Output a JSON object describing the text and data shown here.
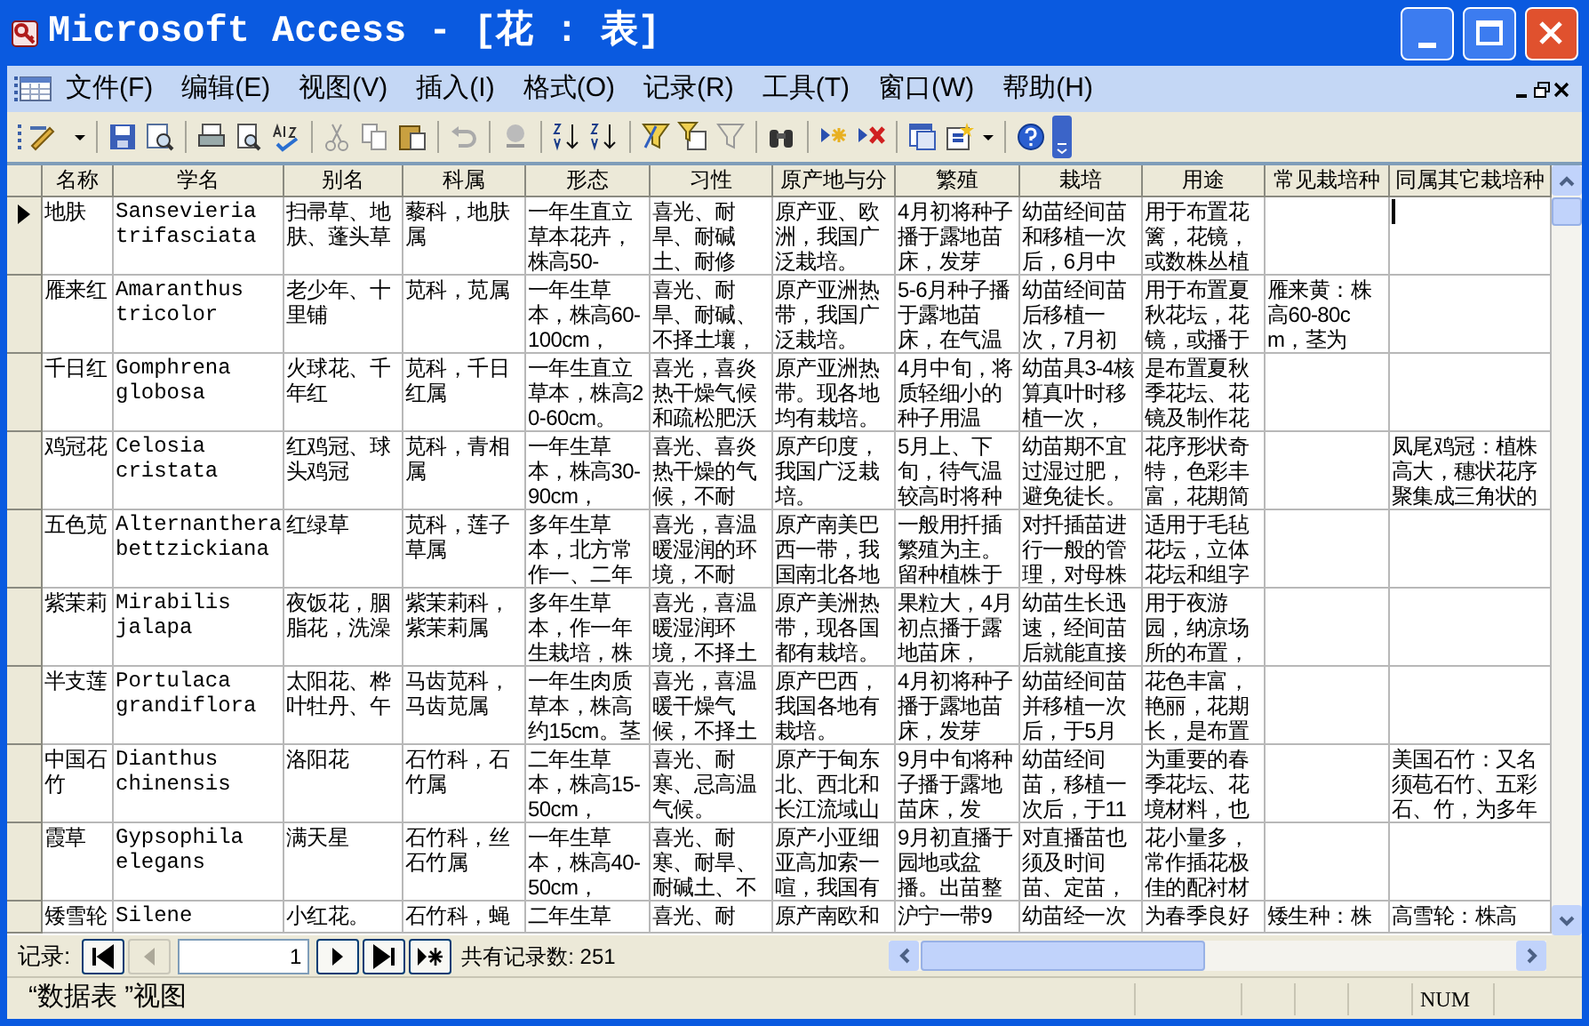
{
  "window": {
    "title": "Microsoft Access - [花 : 表]"
  },
  "menu": [
    "文件(F)",
    "编辑(E)",
    "视图(V)",
    "插入(I)",
    "格式(O)",
    "记录(R)",
    "工具(T)",
    "窗口(W)",
    "帮助(H)"
  ],
  "table": {
    "columns": [
      "名称",
      "学名",
      "别名",
      "科属",
      "形态",
      "习性",
      "原产地与分",
      "繁殖",
      "栽培",
      "用途",
      "常见栽培种",
      "同属其它栽培种"
    ],
    "rows": [
      {
        "current": true,
        "cells": [
          "地肤",
          "Sansevieria trifasciata",
          "扫帚草、地肤、蓬头草",
          "藜科，地肤属",
          "一年生直立草本花卉，株高50-",
          "喜光、耐旱、耐碱土、耐修",
          "原产亚、欧洲，我国广泛栽培。",
          "4月初将种子播于露地苗床，发芽",
          "幼苗经间苗和移植一次后，6月中",
          "用于布置花篱，花镜，或数株丛植",
          null,
          null
        ]
      },
      {
        "current": false,
        "cells": [
          "雁来红",
          "Amaranthus tricolor",
          "老少年、十里铺",
          "苋科，苋属",
          "一年生草本，株高60-100cm，",
          "喜光、耐旱、耐碱、不择土壤，",
          "原产亚洲热带，我国广泛栽培。",
          "5-6月种子播于露地苗床，在气温",
          "幼苗经间苗后移植一次，7月初",
          "用于布置夏秋花坛，花镜，或播于",
          "雁来黄：株高60-80cm，茎为",
          null
        ]
      },
      {
        "current": false,
        "cells": [
          "千日红",
          "Gomphrena globosa",
          "火球花、千年红",
          "苋科，千日红属",
          "一年生直立草本，株高20-60cm。",
          "喜光，喜炎热干燥气候和疏松肥沃",
          "原产亚洲热带。现各地均有栽培。",
          "4月中旬，将质轻细小的种子用温",
          "幼苗具3-4核算真叶时移植一次，",
          "是布置夏秋季花坛、花镜及制作花",
          null,
          null
        ]
      },
      {
        "current": false,
        "cells": [
          "鸡冠花",
          "Celosia cristata",
          "红鸡冠、球头鸡冠",
          "苋科，青相属",
          "一年生草本，株高30-90cm，",
          "喜光、喜炎热干燥的气候，不耐",
          "原产印度，我国广泛栽培。",
          "5月上、下旬，待气温较高时将种",
          "幼苗期不宜过湿过肥，避免徒长。",
          "花序形状奇特，色彩丰富，花期简",
          null,
          "凤尾鸡冠：植株高大，穗状花序聚集成三角状的"
        ]
      },
      {
        "current": false,
        "cells": [
          "五色苋",
          "Alternanthera bettzickiana",
          "红绿草",
          "苋科，莲子草属",
          "多年生草本，北方常作一、二年",
          "喜光，喜温暖湿润的环境，不耐",
          "原产南美巴西一带，我国南北各地",
          "一般用扦插繁殖为主。留种植株于",
          "对扦插苗进行一般的管理，对母株",
          "适用于毛毡花坛，立体花坛和组字",
          null,
          null
        ]
      },
      {
        "current": false,
        "cells": [
          "紫茉莉",
          "Mirabilis jalapa",
          "夜饭花，胭脂花，洗澡",
          "紫茉莉科，紫茉莉属",
          "多年生草本，作一年生栽培，株",
          "喜光，喜温暖湿润环境，不择土",
          "原产美洲热带，现各国都有栽培。",
          "果粒大，4月初点播于露地苗床，",
          "幼苗生长迅速，经间苗后就能直接",
          "用于夜游园，纳凉场所的布置，",
          null,
          null
        ]
      },
      {
        "current": false,
        "cells": [
          "半支莲",
          "Portulaca grandiflora",
          "太阳花、桦叶牡丹、午",
          "马齿苋科，马齿苋属",
          "一年生肉质草本，株高约15cm。茎",
          "喜光，喜温暖干燥气候，不择土",
          "原产巴西，我国各地有栽培。",
          "4月初将种子播于露地苗床，发芽",
          "幼苗经间苗并移植一次后，于5月",
          "花色丰富，艳丽，花期长，是布置",
          null,
          null
        ]
      },
      {
        "current": false,
        "cells": [
          "中国石竹",
          "Dianthus chinensis",
          "洛阳花",
          "石竹科，石竹属",
          "二年生草本，株高15-50cm，",
          "喜光、耐寒、忌高温气候。",
          "原产于甸东北、西北和长江流域山",
          "9月中旬将种子播于露地苗床，发",
          "幼苗经间苗，移植一次后，于11",
          "为重要的春季花坛、花境材料，也",
          null,
          "美国石竹：又名须苞石竹、五彩石、竹，为多年"
        ]
      },
      {
        "current": false,
        "cells": [
          "霞草",
          "Gypsophila elegans",
          "满天星",
          "石竹科，丝石竹属",
          "一年生草本，株高40-50cm，",
          "喜光、耐寒、耐旱、耐碱土、不",
          "原产小亚细亚高加索一喧，我国有",
          "9月初直播于园地或盆播。出苗整",
          "对直播苗也须及时间苗、定苗，",
          "花小量多，常作插花极佳的配衬材",
          null,
          null
        ]
      },
      {
        "current": false,
        "cells": [
          "矮雪轮",
          "Silene",
          "小红花。",
          "石竹科，蝇",
          "二年生草",
          "喜光、耐",
          "原产南欧和",
          "沪宁一带9",
          "幼苗经一次",
          "为春季良好",
          "矮生种：株",
          "高雪轮：株高"
        ]
      }
    ]
  },
  "navigation": {
    "label": "记录:",
    "record": "1",
    "count": "共有记录数: 251",
    "buttons": [
      {
        "kind": "first",
        "disabled": false
      },
      {
        "kind": "previous",
        "disabled": true
      },
      {
        "kind": "next",
        "disabled": false
      },
      {
        "kind": "last",
        "disabled": false
      },
      {
        "kind": "new",
        "disabled": false
      }
    ]
  },
  "status_bar": {
    "text": "“数据表 ”视图",
    "indicator": "NUM"
  }
}
